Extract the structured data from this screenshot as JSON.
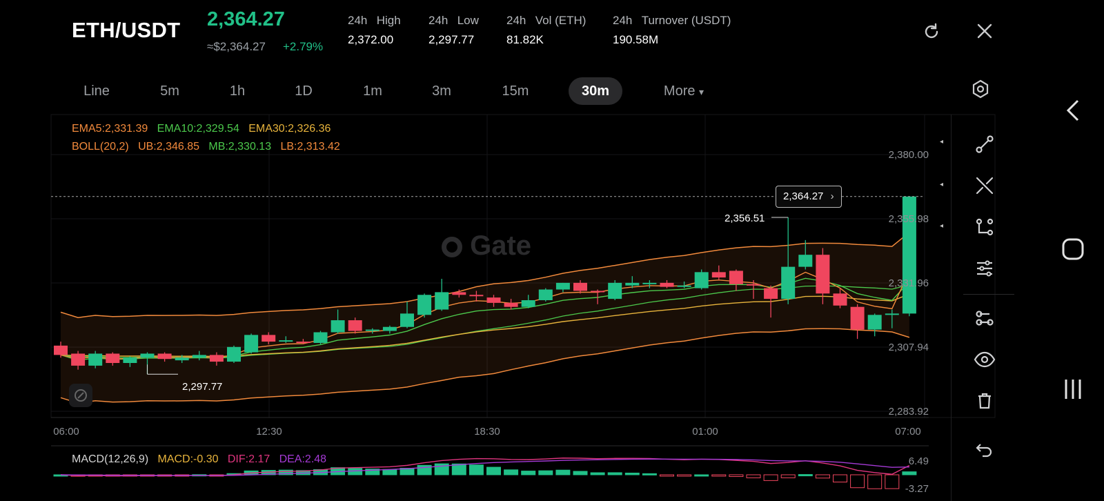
{
  "header": {
    "pair": "ETH/USDT",
    "last_price": "2,364.27",
    "usd_price": "≈$2,364.27",
    "change_pct": "+2.79%",
    "stats": [
      {
        "label_a": "24h",
        "label_b": "High",
        "value": "2,372.00"
      },
      {
        "label_a": "24h",
        "label_b": "Low",
        "value": "2,297.77"
      },
      {
        "label_a": "24h",
        "label_b": "Vol (ETH)",
        "value": "81.82K"
      },
      {
        "label_a": "24h",
        "label_b": "Turnover (USDT)",
        "value": "190.58M"
      }
    ],
    "icons": [
      "refresh-icon",
      "close-icon"
    ]
  },
  "timeframes": {
    "tabs": [
      "Line",
      "5m",
      "1h",
      "1D",
      "1m",
      "3m",
      "15m",
      "30m",
      "More"
    ],
    "active": "30m",
    "more_caret": "▾"
  },
  "indicators": {
    "ema5": "EMA5:2,331.39",
    "ema10": "EMA10:2,329.54",
    "ema30": "EMA30:2,326.36",
    "boll": "BOLL(20,2)",
    "ub": "UB:2,346.85",
    "mb": "MB:2,330.13",
    "lb": "LB:2,313.42",
    "macd_name": "MACD(12,26,9)",
    "macd": "MACD:-0.30",
    "dif": "DIF:2.17",
    "dea": "DEA:2.48"
  },
  "price_axis": [
    "2,380.00",
    "2,355.98",
    "2,331.96",
    "2,307.94",
    "2,283.92"
  ],
  "time_axis": [
    "06:00",
    "12:30",
    "18:30",
    "01:00",
    "07:00"
  ],
  "macd_axis": [
    "6.49",
    "-3.27"
  ],
  "markers": {
    "current_price": "2,364.27",
    "high_label": "2,356.51",
    "low_label": "2,297.77",
    "chevron": "›"
  },
  "watermark": "Gate",
  "colors": {
    "up": "#21c088",
    "down": "#f0465e",
    "ema5": "#f28a3c",
    "ema10": "#4cc94c",
    "ema30": "#e8b43c",
    "boll_band": "#f28a3c",
    "dif": "#e0357f",
    "dea": "#a53ad6"
  },
  "chart_data": {
    "type": "candlestick",
    "interval": "30m",
    "y_range": [
      2283.92,
      2380.0
    ],
    "candles": [
      {
        "o": 2308.5,
        "h": 2310.0,
        "l": 2304.0,
        "c": 2305.0
      },
      {
        "o": 2305.5,
        "h": 2306.5,
        "l": 2299.5,
        "c": 2301.0
      },
      {
        "o": 2301.0,
        "h": 2306.5,
        "l": 2300.0,
        "c": 2305.5
      },
      {
        "o": 2305.5,
        "h": 2306.0,
        "l": 2301.0,
        "c": 2302.0
      },
      {
        "o": 2302.0,
        "h": 2304.5,
        "l": 2300.5,
        "c": 2304.0
      },
      {
        "o": 2304.0,
        "h": 2306.0,
        "l": 2297.8,
        "c": 2305.5
      },
      {
        "o": 2305.5,
        "h": 2306.0,
        "l": 2302.5,
        "c": 2303.5
      },
      {
        "o": 2303.0,
        "h": 2305.0,
        "l": 2302.0,
        "c": 2304.0
      },
      {
        "o": 2304.0,
        "h": 2306.5,
        "l": 2303.0,
        "c": 2305.0
      },
      {
        "o": 2305.0,
        "h": 2306.0,
        "l": 2301.0,
        "c": 2302.5
      },
      {
        "o": 2302.5,
        "h": 2308.5,
        "l": 2302.0,
        "c": 2308.0
      },
      {
        "o": 2306.0,
        "h": 2313.0,
        "l": 2305.5,
        "c": 2312.5
      },
      {
        "o": 2312.5,
        "h": 2313.5,
        "l": 2309.0,
        "c": 2310.0
      },
      {
        "o": 2310.0,
        "h": 2312.0,
        "l": 2309.5,
        "c": 2310.5
      },
      {
        "o": 2310.0,
        "h": 2311.0,
        "l": 2309.0,
        "c": 2309.5
      },
      {
        "o": 2309.5,
        "h": 2314.0,
        "l": 2309.0,
        "c": 2313.5
      },
      {
        "o": 2313.5,
        "h": 2322.0,
        "l": 2313.0,
        "c": 2318.0
      },
      {
        "o": 2318.0,
        "h": 2319.0,
        "l": 2313.0,
        "c": 2314.0
      },
      {
        "o": 2314.0,
        "h": 2315.0,
        "l": 2313.0,
        "c": 2314.5
      },
      {
        "o": 2314.0,
        "h": 2316.0,
        "l": 2313.0,
        "c": 2315.5
      },
      {
        "o": 2315.5,
        "h": 2325.0,
        "l": 2315.0,
        "c": 2320.5
      },
      {
        "o": 2320.0,
        "h": 2328.0,
        "l": 2319.0,
        "c": 2327.5
      },
      {
        "o": 2322.0,
        "h": 2333.5,
        "l": 2321.5,
        "c": 2328.5
      },
      {
        "o": 2328.5,
        "h": 2329.5,
        "l": 2326.5,
        "c": 2327.5
      },
      {
        "o": 2327.5,
        "h": 2329.0,
        "l": 2325.0,
        "c": 2327.0
      },
      {
        "o": 2326.5,
        "h": 2327.5,
        "l": 2323.0,
        "c": 2324.5
      },
      {
        "o": 2324.5,
        "h": 2326.0,
        "l": 2322.0,
        "c": 2323.0
      },
      {
        "o": 2323.0,
        "h": 2327.5,
        "l": 2322.5,
        "c": 2325.5
      },
      {
        "o": 2325.5,
        "h": 2330.0,
        "l": 2325.0,
        "c": 2329.5
      },
      {
        "o": 2329.5,
        "h": 2332.0,
        "l": 2328.5,
        "c": 2332.0
      },
      {
        "o": 2332.0,
        "h": 2333.0,
        "l": 2328.0,
        "c": 2329.0
      },
      {
        "o": 2329.0,
        "h": 2329.5,
        "l": 2324.0,
        "c": 2328.5
      },
      {
        "o": 2326.0,
        "h": 2333.0,
        "l": 2325.5,
        "c": 2332.0
      },
      {
        "o": 2331.0,
        "h": 2334.5,
        "l": 2330.0,
        "c": 2332.0
      },
      {
        "o": 2331.5,
        "h": 2333.0,
        "l": 2330.0,
        "c": 2332.0
      },
      {
        "o": 2332.0,
        "h": 2333.0,
        "l": 2330.0,
        "c": 2330.5
      },
      {
        "o": 2330.5,
        "h": 2332.5,
        "l": 2330.0,
        "c": 2331.0
      },
      {
        "o": 2330.0,
        "h": 2337.0,
        "l": 2329.5,
        "c": 2336.0
      },
      {
        "o": 2336.0,
        "h": 2338.5,
        "l": 2333.0,
        "c": 2334.0
      },
      {
        "o": 2336.5,
        "h": 2337.0,
        "l": 2329.0,
        "c": 2331.5
      },
      {
        "o": 2331.5,
        "h": 2333.0,
        "l": 2326.0,
        "c": 2331.0
      },
      {
        "o": 2330.0,
        "h": 2331.0,
        "l": 2319.0,
        "c": 2326.0
      },
      {
        "o": 2326.0,
        "h": 2356.5,
        "l": 2324.0,
        "c": 2338.0
      },
      {
        "o": 2338.0,
        "h": 2348.0,
        "l": 2337.0,
        "c": 2342.5
      },
      {
        "o": 2342.5,
        "h": 2345.0,
        "l": 2324.0,
        "c": 2328.0
      },
      {
        "o": 2328.0,
        "h": 2330.0,
        "l": 2322.5,
        "c": 2323.5
      },
      {
        "o": 2323.0,
        "h": 2324.0,
        "l": 2311.0,
        "c": 2314.5
      },
      {
        "o": 2314.5,
        "h": 2320.5,
        "l": 2312.0,
        "c": 2320.0
      },
      {
        "o": 2320.0,
        "h": 2322.0,
        "l": 2315.0,
        "c": 2320.5
      },
      {
        "o": 2320.5,
        "h": 2364.3,
        "l": 2319.5,
        "c": 2364.3
      }
    ]
  }
}
